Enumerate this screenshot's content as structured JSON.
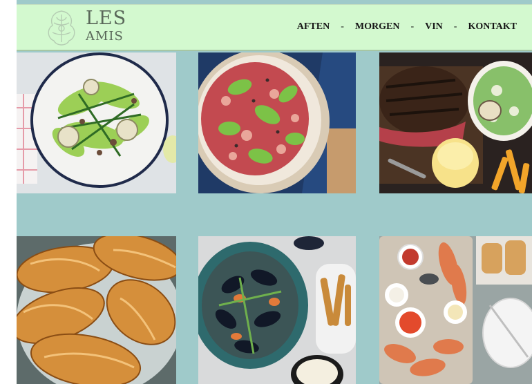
{
  "header": {
    "logo": {
      "line1": "LES",
      "line2": "AMIS"
    },
    "nav": [
      {
        "label": "AFTEN"
      },
      {
        "label": "MORGEN"
      },
      {
        "label": "VIN"
      },
      {
        "label": "KONTAKT"
      }
    ],
    "separator": "-"
  },
  "gallery": {
    "tiles": [
      {
        "subject": "green-salad-plate"
      },
      {
        "subject": "tartare-bowl"
      },
      {
        "subject": "steak-board"
      },
      {
        "subject": "croissants"
      },
      {
        "subject": "mussels-bowl"
      },
      {
        "subject": "seafood-platter"
      }
    ]
  },
  "colors": {
    "background": "#9fcaca",
    "header": "#d3f9cf",
    "nav_text": "#161616",
    "logo_text": "#596759"
  }
}
